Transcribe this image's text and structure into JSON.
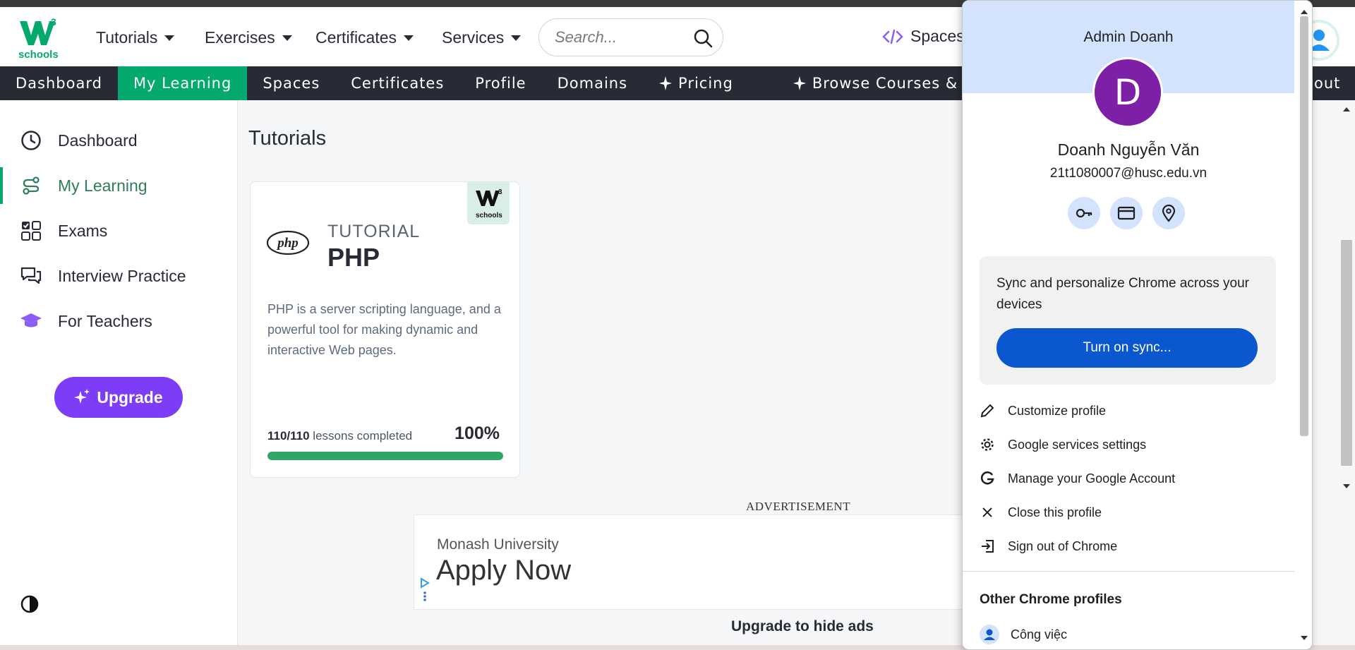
{
  "topnav": {
    "logo_text": "schools",
    "logo_mark": "w3",
    "menus": [
      {
        "label": "Tutorials"
      },
      {
        "label": "Exercises"
      },
      {
        "label": "Certificates"
      },
      {
        "label": "Services"
      }
    ],
    "search_placeholder": "Search...",
    "spaces_label": "Spaces"
  },
  "subnav": {
    "items": [
      "Dashboard",
      "My Learning",
      "Spaces",
      "Certificates",
      "Profile",
      "Domains",
      "Pricing",
      "Browse Courses & Ex"
    ],
    "tail": "out"
  },
  "sidebar": {
    "items": [
      "Dashboard",
      "My Learning",
      "Exams",
      "Interview Practice",
      "For Teachers"
    ],
    "upgrade_label": "Upgrade"
  },
  "main": {
    "title": "Tutorials",
    "card": {
      "logo_text": "php",
      "badge_text": "schools",
      "kind": "TUTORIAL",
      "name": "PHP",
      "description": "PHP is a server scripting language, and a powerful tool for making dynamic and interactive Web pages.",
      "lessons_count": "110/110",
      "lessons_suffix": " lessons completed",
      "percent_label": "100%",
      "progress": 1.0
    },
    "ad": {
      "label": "ADVERTISEMENT",
      "advertiser": "Monash University",
      "headline": "Apply Now",
      "hide_ads": "Upgrade to hide ads"
    }
  },
  "popup": {
    "header_name": "Admin Doanh",
    "avatar_letter": "D",
    "user_name": "Doanh Nguyễn Văn",
    "email": "21t1080007@husc.edu.vn",
    "sync_text": "Sync and personalize Chrome across your devices",
    "sync_button": "Turn on sync...",
    "menu": [
      "Customize profile",
      "Google services settings",
      "Manage your Google Account",
      "Close this profile",
      "Sign out of Chrome"
    ],
    "other_profiles_title": "Other Chrome profiles",
    "other_profile": "Công việc",
    "colors": {
      "header": "#d3e3fd",
      "avatar": "#7e1fa8",
      "button": "#0b57d0"
    }
  },
  "colors": {
    "brand_green": "#04aa6d",
    "dark": "#282a35",
    "purple": "#7d3cf6"
  }
}
